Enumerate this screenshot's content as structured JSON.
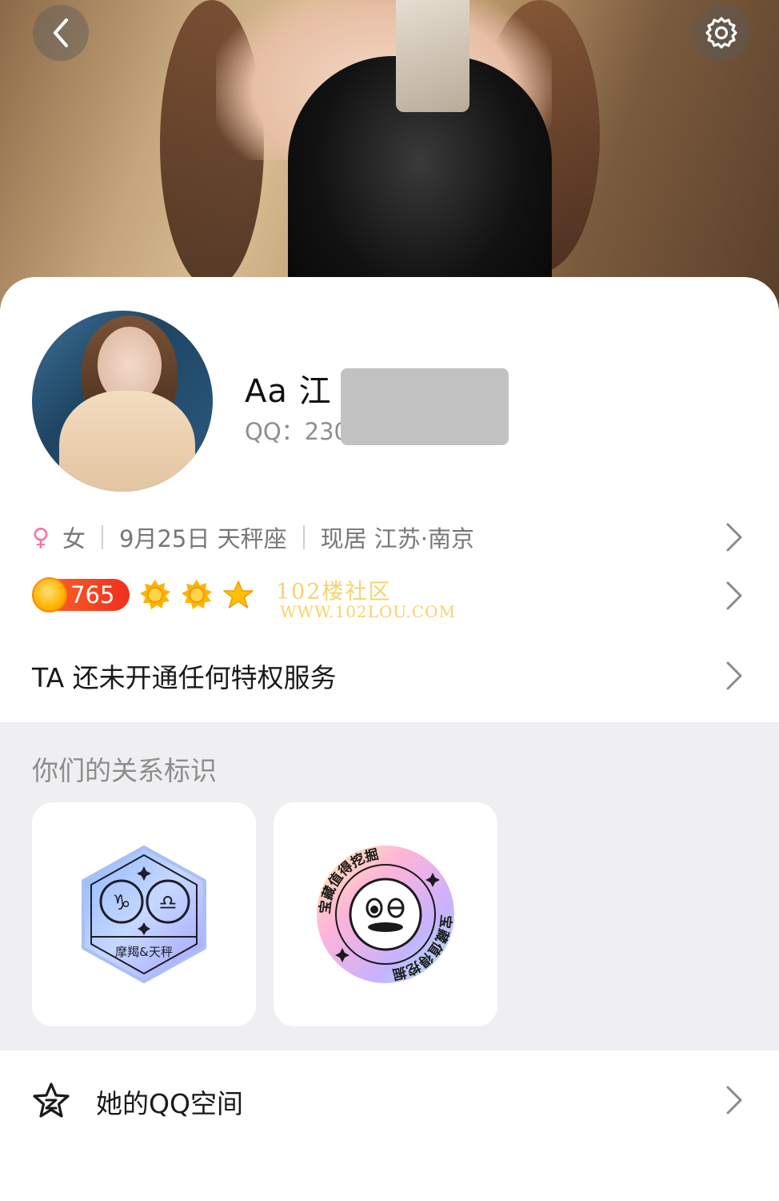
{
  "header": {
    "back_icon": "chevron-left-icon",
    "settings_icon": "gear-icon"
  },
  "profile": {
    "nickname": "Aa  江",
    "qq_label": "QQ：230",
    "gender": "女",
    "birthday": "9月25日 天秤座",
    "location": "现居 江苏·南京",
    "level": "765",
    "level_icons": [
      "sun-icon",
      "sun-icon",
      "star-icon"
    ]
  },
  "watermark": {
    "line1": "102楼社区",
    "line2": "WWW.102LOU.COM"
  },
  "privilege": {
    "text": "TA 还未开通任何特权服务"
  },
  "relation": {
    "title": "你们的关系标识",
    "badge1_text": "摩羯&天秤",
    "badge2_text": "宝藏值得挖掘"
  },
  "qzone": {
    "label": "她的QQ空间",
    "icon": "star-outline-icon"
  },
  "colors": {
    "accent_female": "#ff6fa2",
    "level_pill": "#ef2f1e",
    "section_bg": "#efeff2",
    "watermark": "#f5d36b"
  }
}
